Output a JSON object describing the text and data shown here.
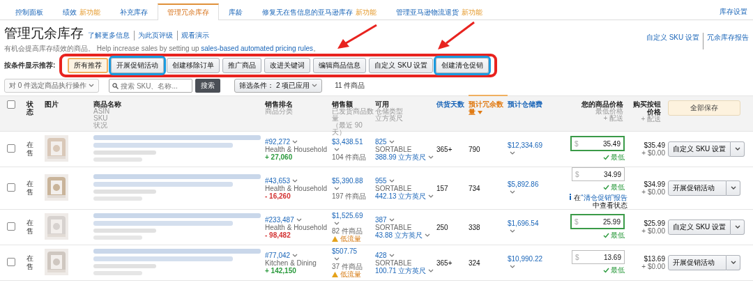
{
  "tabs": [
    {
      "label": "控制面板",
      "selected": false
    },
    {
      "label": "绩效",
      "badge": "新功能",
      "selected": false
    },
    {
      "label": "补充库存",
      "selected": false
    },
    {
      "label": "管理冗余库存",
      "selected": true
    },
    {
      "label": "库龄",
      "selected": false
    },
    {
      "label": "修复无在售信息的亚马逊库存",
      "badge": "新功能",
      "selected": false
    },
    {
      "label": "管理亚马逊物流退货",
      "badge": "新功能",
      "selected": false
    }
  ],
  "settings_link": "库存设置",
  "header": {
    "title": "管理冗余库存",
    "links": [
      "了解更多信息",
      "为此页评级",
      "观看演示"
    ],
    "description": "有机会提高库存绩效的商品。",
    "help_text": "Help increase sales by setting up",
    "help_link": "sales-based automated pricing rules",
    "help_end": "。",
    "right_links": [
      "自定义 SKU 设置",
      "冗余库存报告"
    ]
  },
  "filters": {
    "label": "按条件显示推荐:",
    "buttons": [
      {
        "label": "所有推荐",
        "selected": true,
        "highlighted": false
      },
      {
        "label": "开展促销活动",
        "selected": false,
        "highlighted": true
      },
      {
        "label": "创建移除订单",
        "selected": false,
        "highlighted": false
      },
      {
        "label": "推广商品",
        "selected": false,
        "highlighted": false
      },
      {
        "label": "改进关键词",
        "selected": false,
        "highlighted": false
      },
      {
        "label": "编辑商品信息",
        "selected": false,
        "highlighted": false
      },
      {
        "label": "自定义 SKU 设置",
        "selected": false,
        "highlighted": false
      },
      {
        "label": "创建清仓促销",
        "selected": false,
        "highlighted": true
      }
    ]
  },
  "toolbar": {
    "bulk_action": "对 0 件选定商品执行操作",
    "search_placeholder": "搜索 SKU、名称...",
    "search_button": "搜索",
    "filter": "筛选条件： 2 项已应用",
    "count": "11 件商品"
  },
  "table": {
    "select_all_checked": false,
    "save_all": "全部保存",
    "columns": [
      {
        "label": "状态",
        "kind": "plain"
      },
      {
        "label": "图片",
        "kind": "plain"
      },
      {
        "label": "商品名称",
        "kind": "plain",
        "sub": [
          "ASIN",
          "SKU",
          "状况"
        ]
      },
      {
        "label": "销售排名",
        "kind": "plain",
        "sub": [
          "商品分类"
        ]
      },
      {
        "label": "销售额",
        "kind": "plain",
        "sub": [
          "已发货商品数量",
          "（最近 90 天）"
        ]
      },
      {
        "label": "可用",
        "kind": "plain",
        "sub": [
          "仓储类型",
          "立方英尺"
        ]
      },
      {
        "label": "供货天数",
        "kind": "link"
      },
      {
        "label": "预计冗余数量",
        "kind": "sorted"
      },
      {
        "label": "预计仓储费",
        "kind": "link"
      },
      {
        "label": "您的商品价格",
        "kind": "plain",
        "sub": [
          "最低价格",
          "+ 配送"
        ]
      },
      {
        "label": "购买按钮价格",
        "kind": "plain",
        "sub": [
          "+ 配送"
        ]
      }
    ],
    "rows": [
      {
        "checked": false,
        "status": "在售",
        "rank": "#92,272",
        "category": "Health & Household",
        "rank_change": {
          "text": "+ 27,060",
          "color": "#2b9a3d"
        },
        "sales": "$3,438.51",
        "units": "104 件商品",
        "available": "825",
        "storage_type": "SORTABLE",
        "volume": "388.99 立方英尺",
        "days": "365+",
        "excess": "790",
        "fee": "$12,334.69",
        "currency": "$",
        "price": "35.49",
        "price_highlighted": true,
        "price_status": "最低",
        "buy_box": "$35.49",
        "shipping": "+ $0.00",
        "action": "自定义 SKU 设置"
      },
      {
        "checked": false,
        "status": "在售",
        "rank": "#43,653",
        "category": "Health & Household",
        "rank_change": {
          "text": "- 16,260",
          "color": "#d33333"
        },
        "sales": "$5,390.88",
        "units": "197 件商品",
        "available": "955",
        "storage_type": "SORTABLE",
        "volume": "442.13 立方英尺",
        "days": "157",
        "excess": "734",
        "fee": "$5,892.86",
        "currency": "$",
        "price": "34.99",
        "price_highlighted": false,
        "price_status": "最低",
        "note": {
          "prefix": "在",
          "link": "“清仓促销”报告",
          "suffix": "中查看状态"
        },
        "buy_box": "$34.99",
        "shipping": "+ $0.00",
        "action": "开展促销活动"
      },
      {
        "checked": false,
        "status": "在售",
        "rank": "#233,487",
        "category": "Health & Household",
        "rank_change": {
          "text": "- 98,482",
          "color": "#d33333"
        },
        "sales": "$1,525.69",
        "units": "82 件商品",
        "warning": "低流量",
        "available": "387",
        "storage_type": "SORTABLE",
        "volume": "43.88 立方英尺",
        "days": "250",
        "excess": "338",
        "fee": "$1,696.54",
        "currency": "$",
        "price": "25.99",
        "price_highlighted": true,
        "price_status": "最低",
        "buy_box": "$25.99",
        "shipping": "+ $0.00",
        "action": "自定义 SKU 设置"
      },
      {
        "checked": false,
        "status": "在售",
        "rank": "#77,042",
        "category": "Kitchen & Dining",
        "rank_change": {
          "text": "+ 142,150",
          "color": "#2b9a3d"
        },
        "sales": "$507.75",
        "units": "37 件商品",
        "warning": "低流量",
        "available": "428",
        "storage_type": "SORTABLE",
        "volume": "100.71 立方英尺",
        "days": "365+",
        "excess": "324",
        "fee": "$10,990.22",
        "currency": "$",
        "price": "13.69",
        "price_highlighted": false,
        "price_status": "最低",
        "buy_box": "$13.69",
        "shipping": "+ $0.00",
        "action": "开展促销活动"
      }
    ]
  }
}
